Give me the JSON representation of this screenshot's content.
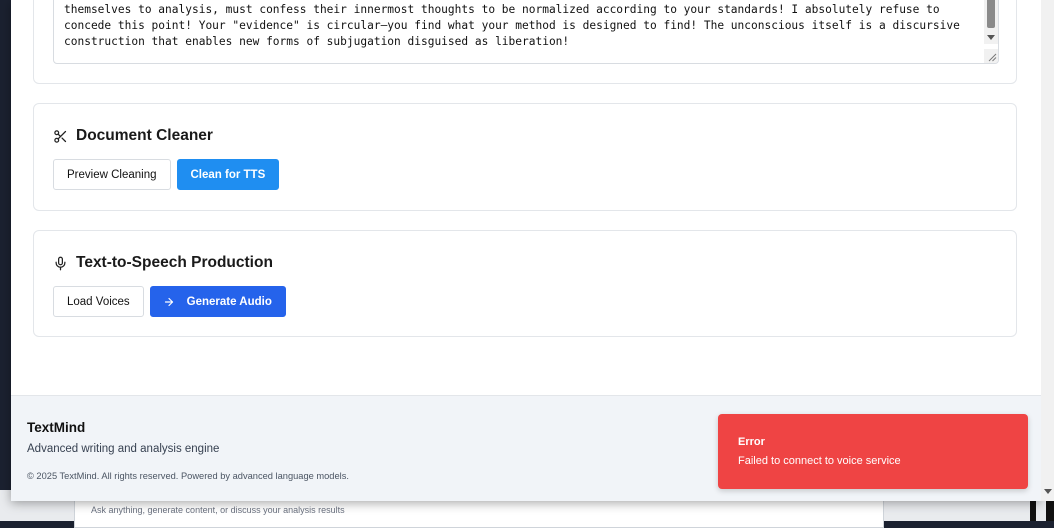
{
  "background": {
    "input_placeholder": "Ask anything, generate content, or discuss your analysis results"
  },
  "source_text": {
    "value": "themselves to analysis, must confess their innermost thoughts to be normalized according to your standards! I absolutely refuse to concede this point! Your \"evidence\" is circular—you find what your method is designed to find! The unconscious itself is a discursive construction that enables new forms of subjugation disguised as liberation!"
  },
  "document_cleaner": {
    "title": "Document Cleaner",
    "icon": "scissors-icon",
    "preview_label": "Preview Cleaning",
    "clean_label": "Clean for TTS"
  },
  "tts": {
    "title": "Text-to-Speech Production",
    "icon": "microphone-icon",
    "load_voices_label": "Load Voices",
    "generate_label": "Generate Audio"
  },
  "footer": {
    "brand": "TextMind",
    "tagline": "Advanced writing and analysis engine",
    "copyright": "© 2025 TextMind. All rights reserved. Powered by advanced language models."
  },
  "toast": {
    "title": "Error",
    "message": "Failed to connect to voice service",
    "color": "#ef4444"
  },
  "colors": {
    "cyan_button": "#1f8ef1",
    "primary_button": "#2563eb"
  }
}
